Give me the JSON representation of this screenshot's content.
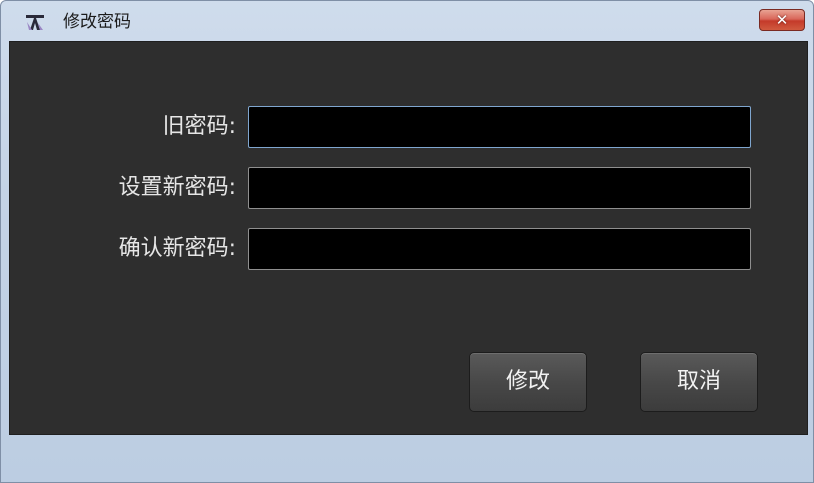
{
  "window": {
    "title": "修改密码",
    "icon": "app-tool-icon",
    "close_glyph": "✕"
  },
  "form": {
    "old_password_label": "旧密码:",
    "new_password_label": "设置新密码:",
    "confirm_password_label": "确认新密码:",
    "old_password_value": "",
    "new_password_value": "",
    "confirm_password_value": ""
  },
  "buttons": {
    "modify": "修改",
    "cancel": "取消"
  },
  "colors": {
    "titlebar": "#c4d3e6",
    "client_bg": "#2e2e2e",
    "input_bg": "#000000",
    "close_red": "#c43a2a"
  }
}
